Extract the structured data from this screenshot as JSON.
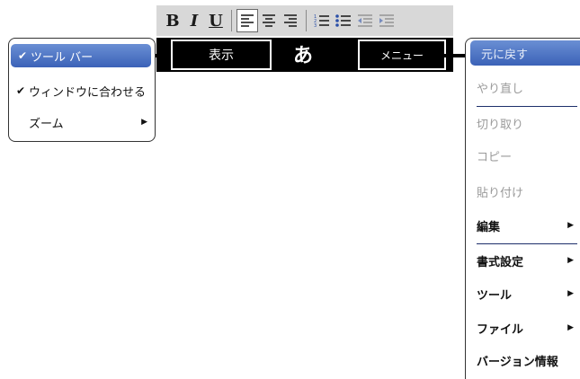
{
  "toolbar": {
    "bold": "B",
    "italic": "I",
    "underline": "U"
  },
  "blackbar": {
    "display_label": "表示",
    "kana": "あ",
    "menu_label": "メニュー"
  },
  "left_menu": {
    "items": [
      {
        "label": "ツール バー",
        "checked": "✔",
        "selected": true
      },
      {
        "label": "ウィンドウに合わせる",
        "checked": "✔"
      },
      {
        "label": "ズーム",
        "submenu": "▶"
      }
    ]
  },
  "right_menu": {
    "items": [
      {
        "label": "元に戻す",
        "state": "selected"
      },
      {
        "label": "やり直し",
        "state": "disabled"
      },
      {
        "label": "切り取り",
        "state": "disabled"
      },
      {
        "label": "コピー",
        "state": "disabled"
      },
      {
        "label": "貼り付け",
        "state": "disabled"
      },
      {
        "label": "編集",
        "submenu": "▶"
      },
      {
        "label": "書式設定",
        "submenu": "▶"
      },
      {
        "label": "ツール",
        "submenu": "▶"
      },
      {
        "label": "ファイル",
        "submenu": "▶"
      },
      {
        "label": "バージョン情報"
      }
    ]
  },
  "colors": {
    "selection": "#3b62b8",
    "toolbar_bg": "#d8d8d8",
    "disabled_text": "#9a9a9a"
  }
}
